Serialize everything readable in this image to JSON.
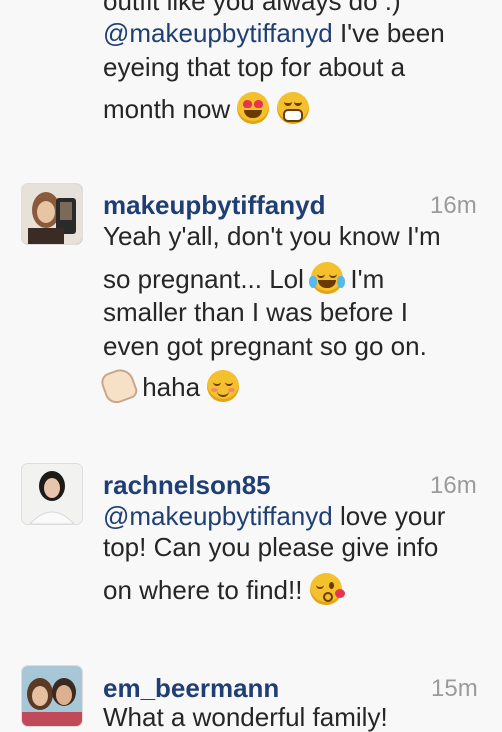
{
  "comments": [
    {
      "top_line_fragment": "outfit like you always do :)",
      "mention": "@makeupbytiffanyd",
      "text_line1_rest": " I've been",
      "text_line2": "eyeing that top for about a",
      "text_line3": "month now"
    },
    {
      "username": "makeupbytiffanyd",
      "time": "16m",
      "line1": "Yeah y'all, don't you know I'm",
      "line2": "so pregnant... Lol",
      "line2_after": " I'm",
      "line3": "smaller than I was before I",
      "line4": "even got pregnant so go on.",
      "line5": " haha"
    },
    {
      "username": "rachnelson85",
      "time": "16m",
      "mention": "@makeupbytiffanyd",
      "line1_rest": " love your",
      "line2": "top! Can you please give info",
      "line3": "on where to find!!"
    },
    {
      "username": "em_beermann",
      "time": "15m",
      "line1": "What a wonderful family!"
    }
  ],
  "icons": {
    "heart_eyes": "heart-eyes-emoji",
    "grimacing": "grimacing-emoji",
    "joy": "tears-of-joy-emoji",
    "wave": "clapping-hand-emoji",
    "relaxed": "smiling-face-emoji",
    "kiss": "face-blowing-kiss-emoji"
  },
  "colors": {
    "username": "#1f3f74",
    "time": "#9b9b9b",
    "background": "#f8f8f8"
  }
}
